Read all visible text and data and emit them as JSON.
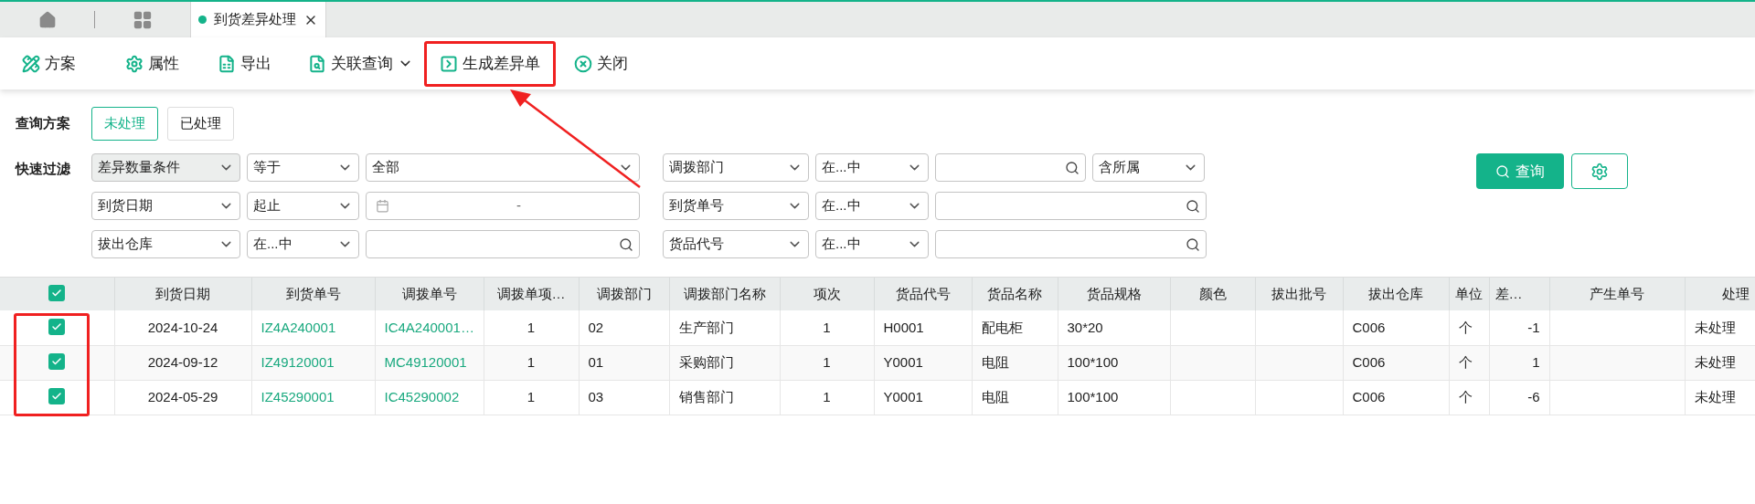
{
  "tabs": [
    {
      "label": "到货差异处理",
      "selected": true
    }
  ],
  "toolbar": [
    {
      "kind": "scheme",
      "label": "方案",
      "dropdown": false
    },
    {
      "kind": "attr",
      "label": "属性",
      "dropdown": false
    },
    {
      "kind": "export",
      "label": "导出",
      "dropdown": false
    },
    {
      "kind": "link",
      "label": "关联查询",
      "dropdown": true
    },
    {
      "kind": "generate",
      "label": "生成差异单",
      "dropdown": false
    },
    {
      "kind": "close",
      "label": "关闭",
      "dropdown": false
    }
  ],
  "query_scheme": {
    "label": "查询方案",
    "options": [
      {
        "label": "未处理",
        "selected": true
      },
      {
        "label": "已处理",
        "selected": false
      }
    ]
  },
  "quick_filter": {
    "label": "快速过滤",
    "rows": [
      [
        {
          "kind": "select",
          "value": "差异数量条件",
          "shaded": true
        },
        {
          "kind": "select",
          "value": "等于",
          "shaded": false
        },
        {
          "kind": "select",
          "value": "全部",
          "shaded": false
        },
        {
          "kind": "select",
          "value": "调拨部门",
          "shaded": false
        },
        {
          "kind": "select",
          "value": "在...中",
          "shaded": false
        },
        {
          "kind": "search"
        },
        {
          "kind": "select",
          "value": "含所属",
          "shaded": false
        }
      ],
      [
        {
          "kind": "select",
          "value": "到货日期",
          "shaded": false
        },
        {
          "kind": "select",
          "value": "起止",
          "shaded": false
        },
        {
          "kind": "date",
          "separator": "-"
        },
        {
          "kind": "select",
          "value": "到货单号",
          "shaded": false
        },
        {
          "kind": "select",
          "value": "在...中",
          "shaded": false
        },
        {
          "kind": "search"
        }
      ],
      [
        {
          "kind": "select",
          "value": "拔出仓库",
          "shaded": false
        },
        {
          "kind": "select",
          "value": "在...中",
          "shaded": false
        },
        {
          "kind": "search"
        },
        {
          "kind": "select",
          "value": "货品代号",
          "shaded": false
        },
        {
          "kind": "select",
          "value": "在...中",
          "shaded": false
        },
        {
          "kind": "search"
        }
      ]
    ],
    "query_button": "查询"
  },
  "table": {
    "all_checked": true,
    "columns": [
      {
        "label": "到货日期",
        "kind": "text"
      },
      {
        "label": "到货单号",
        "kind": "link"
      },
      {
        "label": "调拨单号",
        "kind": "link"
      },
      {
        "label": "调拨单项…",
        "kind": "text"
      },
      {
        "label": "调拨部门",
        "kind": "text"
      },
      {
        "label": "调拨部门名称",
        "kind": "text"
      },
      {
        "label": "项次",
        "kind": "text"
      },
      {
        "label": "货品代号",
        "kind": "text"
      },
      {
        "label": "货品名称",
        "kind": "text"
      },
      {
        "label": "货品规格",
        "kind": "text"
      },
      {
        "label": "颜色",
        "kind": "text"
      },
      {
        "label": "拔出批号",
        "kind": "text"
      },
      {
        "label": "拔出仓库",
        "kind": "text"
      },
      {
        "label": "单位",
        "kind": "text"
      },
      {
        "label": "差…",
        "kind": "text"
      },
      {
        "label": "产生单号",
        "kind": "text"
      },
      {
        "label": "处理",
        "kind": "text"
      }
    ],
    "rows": [
      {
        "checked": true,
        "cells": [
          "2024-10-24",
          "IZ4A240001",
          "IC4A240001…",
          "1",
          "02",
          "生产部门",
          "1",
          "H0001",
          "配电柜",
          "30*20",
          "",
          "",
          "C006",
          "个",
          "-1",
          "",
          "未处理"
        ]
      },
      {
        "checked": true,
        "cells": [
          "2024-09-12",
          "IZ49120001",
          "MC49120001",
          "1",
          "01",
          "采购部门",
          "1",
          "Y0001",
          "电阻",
          "100*100",
          "",
          "",
          "C006",
          "个",
          "1",
          "",
          "未处理"
        ]
      },
      {
        "checked": true,
        "cells": [
          "2024-05-29",
          "IZ45290001",
          "IC45290002",
          "1",
          "03",
          "销售部门",
          "1",
          "Y0001",
          "电阻",
          "100*100",
          "",
          "",
          "C006",
          "个",
          "-6",
          "",
          "未处理"
        ]
      }
    ]
  }
}
